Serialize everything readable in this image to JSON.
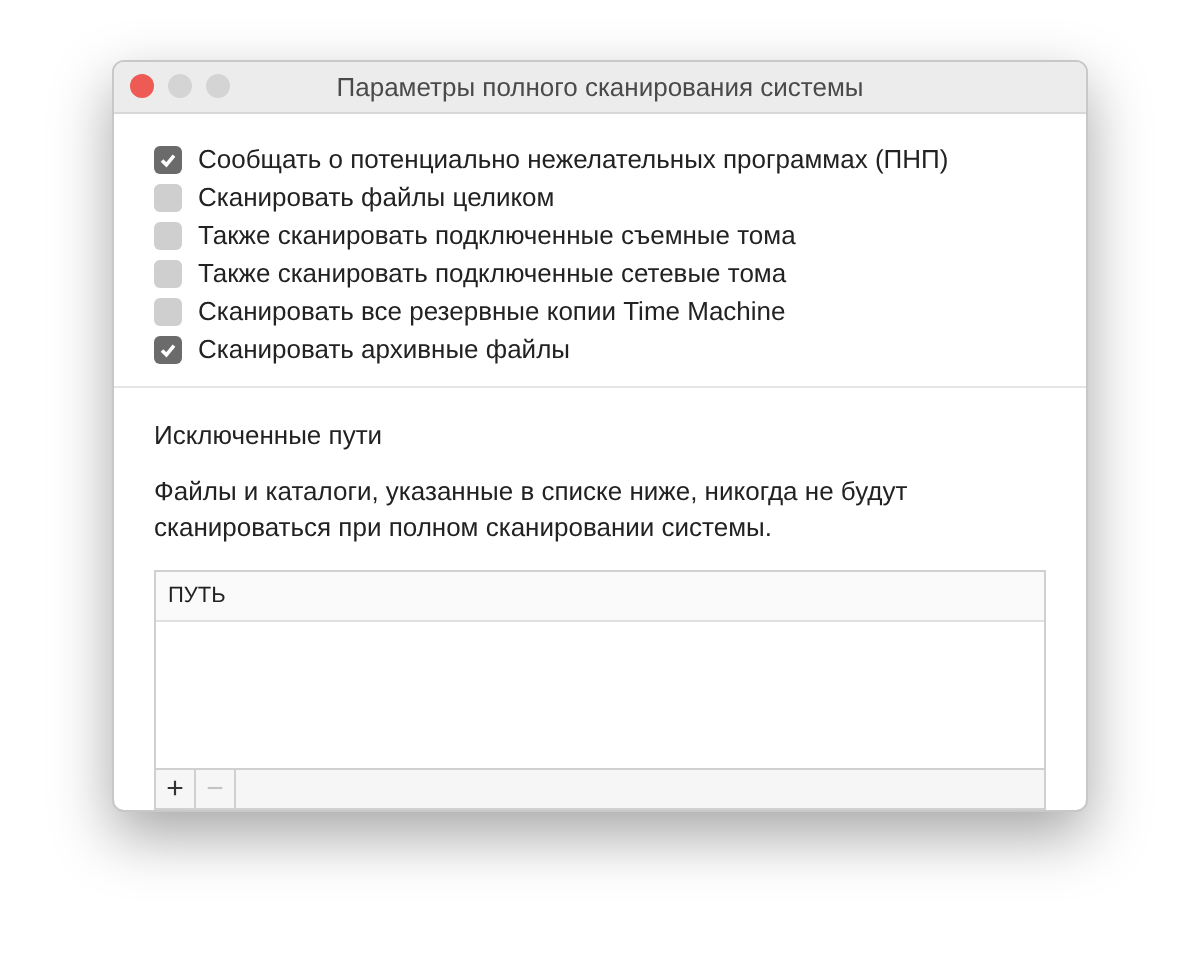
{
  "window": {
    "title": "Параметры полного сканирования системы"
  },
  "options": [
    {
      "label": "Сообщать о потенциально нежелательных программах (ПНП)",
      "checked": true
    },
    {
      "label": "Сканировать файлы целиком",
      "checked": false
    },
    {
      "label": "Также сканировать подключенные съемные тома",
      "checked": false
    },
    {
      "label": "Также сканировать подключенные сетевые тома",
      "checked": false
    },
    {
      "label": "Сканировать все резервные копии Time Machine",
      "checked": false
    },
    {
      "label": "Сканировать архивные файлы",
      "checked": true
    }
  ],
  "excluded": {
    "title": "Исключенные пути",
    "description": "Файлы и каталоги, указанные в списке ниже, никогда не будут сканироваться при полном сканировании системы.",
    "table": {
      "columns": [
        "ПУТЬ"
      ]
    },
    "buttons": [
      {
        "label": "+",
        "disabled": false
      },
      {
        "label": "−",
        "disabled": true
      }
    ]
  }
}
